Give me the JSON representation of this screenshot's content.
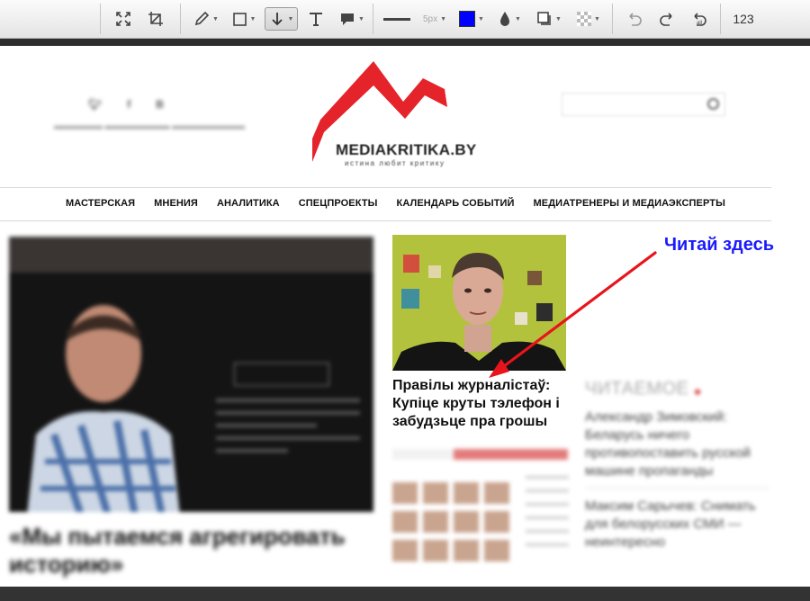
{
  "toolbar": {
    "tools": [
      "fit-icon",
      "crop-icon",
      "pencil-icon",
      "rectangle-icon",
      "arrow-icon",
      "text-icon",
      "callout-icon",
      "line-width-icon",
      "color-icon",
      "opacity-icon",
      "shadow-icon",
      "transparency-icon",
      "undo-icon",
      "redo-icon",
      "revert-icon",
      "numbering-icon"
    ],
    "stroke_size": "5px",
    "color": "#0000ff",
    "number_label": "123"
  },
  "site": {
    "logo_name": "MEDIAKRITIKA.BY",
    "logo_tagline": "истина любит критику",
    "logo_color": "#e5232b",
    "search_placeholder": ""
  },
  "nav": {
    "items": [
      "МАСТЕРСКАЯ",
      "МНЕНИЯ",
      "АНАЛИТИКА",
      "СПЕЦПРОЕКТЫ",
      "КАЛЕНДАРЬ СОБЫТИЙ",
      "МЕДИАТРЕНЕРЫ И МЕДИАЭКСПЕРТЫ"
    ]
  },
  "feature": {
    "title": "«Мы пытаемся агрегировать историю»"
  },
  "article": {
    "title": "Правілы журналістаў: Купіце круты тэлефон і забудзьце пра грошы"
  },
  "readmost": {
    "title": "ЧИТАЕМОЕ",
    "items": [
      "Александр Зимовский: Беларусь ничего противопоставить русской машине пропаганды",
      "Максим Сарычев: Снимать для белорусских СМИ — неинтересно"
    ]
  },
  "annotation": {
    "text": "Читай здесь",
    "color": "#1a1aff",
    "arrow_color": "#e8141c"
  }
}
